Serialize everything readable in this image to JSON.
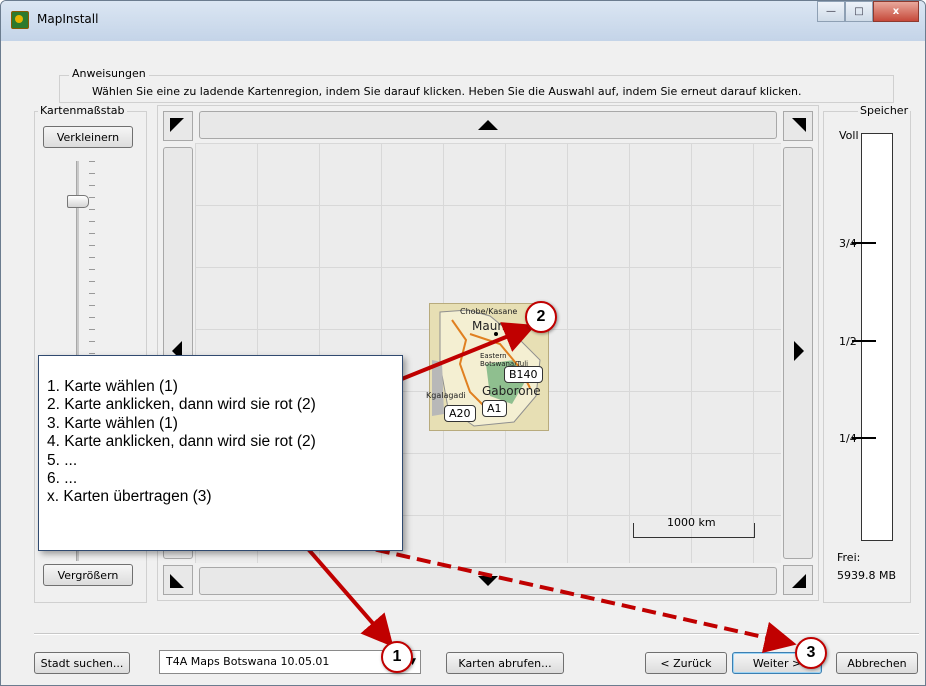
{
  "window": {
    "title": "MapInstall",
    "min": "—",
    "max": "□",
    "close": "x"
  },
  "instructions": {
    "label": "Anweisungen",
    "text": "Wählen Sie eine zu ladende Kartenregion, indem Sie darauf klicken. Heben Sie die Auswahl auf, indem Sie erneut darauf klicken."
  },
  "scale": {
    "label": "Kartenmaßstab",
    "zoom_out": "Verkleinern",
    "zoom_in": "Vergrößern",
    "level": 0.15
  },
  "map": {
    "scale_bar": "1000 km",
    "places": {
      "chobe": "Chobe/Kasane",
      "maun": "Maun",
      "eastern": "Eastern Botswana/Tuli",
      "kgalagadi": "Kgalagadi",
      "gaborone": "Gaborone"
    },
    "roads": {
      "b140": "B140",
      "a20": "A20",
      "a1": "A1"
    }
  },
  "memory": {
    "label": "Speicher",
    "full": "Voll",
    "three_quarter": "3/4",
    "half": "1/2",
    "quarter": "1/4",
    "free_label": "Frei:",
    "free_value": "5939.8 MB"
  },
  "bottom": {
    "find_city": "Stadt suchen...",
    "map_select": "T4A Maps Botswana 10.05.01",
    "fetch": "Karten abrufen...",
    "back": "< Zurück",
    "next": "Weiter >",
    "cancel": "Abbrechen"
  },
  "annotation": {
    "lines": [
      "1. Karte wählen (1)",
      "2. Karte anklicken, dann wird sie rot (2)",
      "3. Karte wählen (1)",
      "4. Karte anklicken, dann wird sie rot (2)",
      "5. ...",
      "6. ...",
      "x. Karten übertragen (3)"
    ],
    "markers": [
      "1",
      "2",
      "3"
    ]
  },
  "colors": {
    "arrow": "#c00000",
    "accent": "#3c7fb1"
  }
}
